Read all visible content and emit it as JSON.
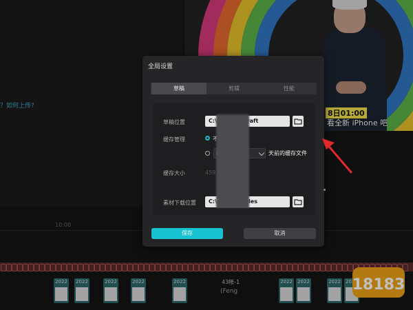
{
  "background": {
    "left_hint": "？如何上传?",
    "preview": {
      "caption_date": "8日01:00",
      "subtitle": "看全新 iPhone 吧"
    },
    "timeline": {
      "ruler_label": "10:00",
      "clips": [
        "2022",
        "2022",
        "2022",
        "2022",
        "2022",
        "2022",
        "2022",
        "2022",
        "2022"
      ],
      "text_clip_label": "43帐-1",
      "text_clip_sub": "(Feng"
    },
    "logo_text": "18183"
  },
  "dialog": {
    "title": "全局设置",
    "tabs": [
      {
        "label": "草稿",
        "active": true
      },
      {
        "label": "剪辑",
        "active": false
      },
      {
        "label": "性能",
        "active": false
      }
    ],
    "draft_location": {
      "label": "草稿位置",
      "path": "C:\\                    ..editor.draft"
    },
    "cache_management": {
      "label": "缓存管理",
      "option_1": "不              件",
      "option_2_prefix": "I",
      "option_2_suffix": "天前的缓存文件"
    },
    "cache_size": {
      "label": "缓存大小",
      "value": "459"
    },
    "material_download": {
      "label": "素材下载位置",
      "path": "C:\\                     ..\\Cloud files"
    },
    "save_label": "保存",
    "cancel_label": "取消"
  },
  "colors": {
    "accent": "#17c2d1",
    "arrow": "#e0282d",
    "dialog_bg": "#252528"
  }
}
